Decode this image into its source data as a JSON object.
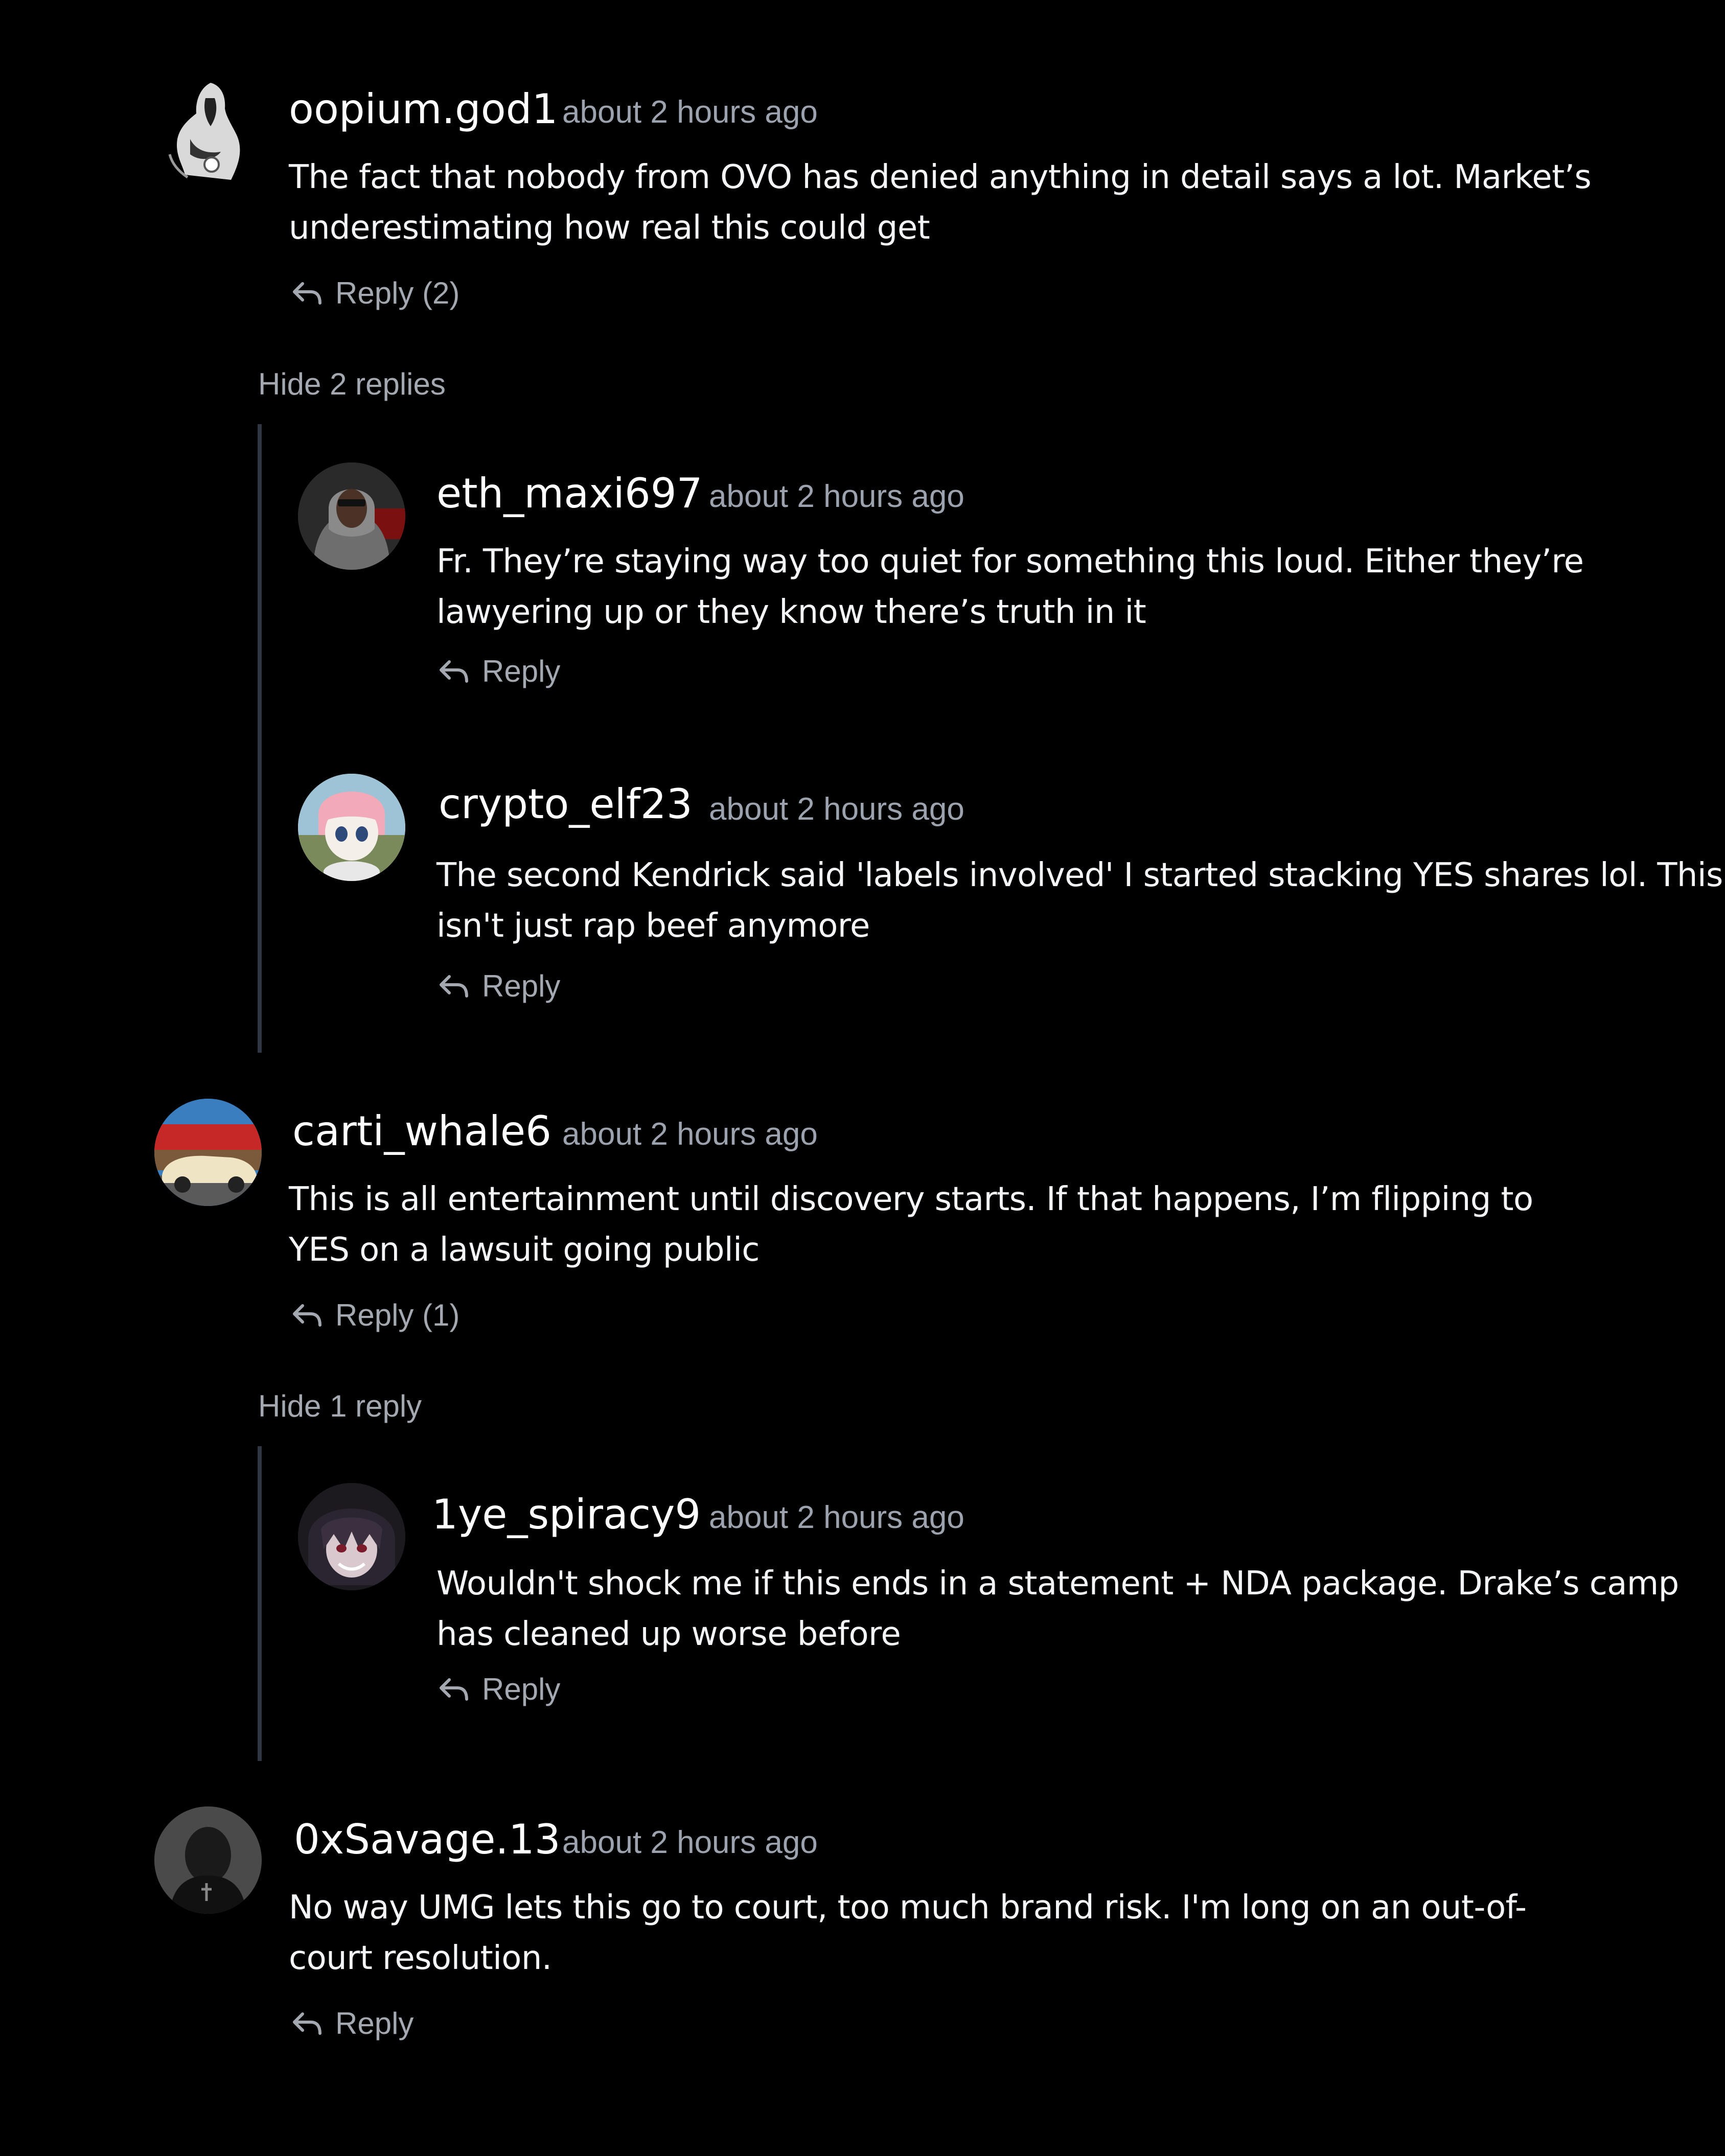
{
  "colors": {
    "background": "#000000",
    "text": "#ffffff",
    "muted": "#9ca3af",
    "thread_line": "#2f3744"
  },
  "comments": [
    {
      "username": "oopium.god1",
      "time": "about 2 hours ago",
      "text": "The fact that nobody from OVO has denied anything in detail says a lot. Market’s underestimating how real this could get",
      "reply_label": "Reply (2)",
      "toggle_label": "Hide 2 replies",
      "avatar_icon": "monochrome-figure-avatar"
    },
    {
      "username": "eth_maxi697",
      "time": "about 2 hours ago",
      "text": "Fr. They’re staying way too quiet for something this loud. Either they’re lawyering up or they know there’s truth in it",
      "reply_label": "Reply",
      "avatar_icon": "hooded-man-avatar"
    },
    {
      "username": "crypto_elf23",
      "time": "about 2 hours ago",
      "text": "The second Kendrick said 'labels involved' I started stacking YES shares lol. This isn't just rap beef anymore",
      "reply_label": "Reply",
      "avatar_icon": "anime-girl-avatar"
    },
    {
      "username": "carti_whale6",
      "time": "about 2 hours ago",
      "text": "This is all entertainment until discovery starts. If that happens, I’m flipping to YES on a lawsuit going public",
      "reply_label": "Reply (1)",
      "toggle_label": "Hide 1 reply",
      "avatar_icon": "vintage-car-avatar"
    },
    {
      "username": "1ye_spiracy9",
      "time": "about 2 hours ago",
      "text": "Wouldn't shock me if this ends in a statement + NDA package. Drake’s camp has cleaned up worse before",
      "reply_label": "Reply",
      "avatar_icon": "anime-dark-avatar"
    },
    {
      "username": "0xSavage.13",
      "time": "about 2 hours ago",
      "text": "No way UMG lets this go to court, too much brand risk. I'm long on an out-of-court resolution.",
      "reply_label": "Reply",
      "avatar_icon": "dark-portrait-avatar"
    }
  ]
}
